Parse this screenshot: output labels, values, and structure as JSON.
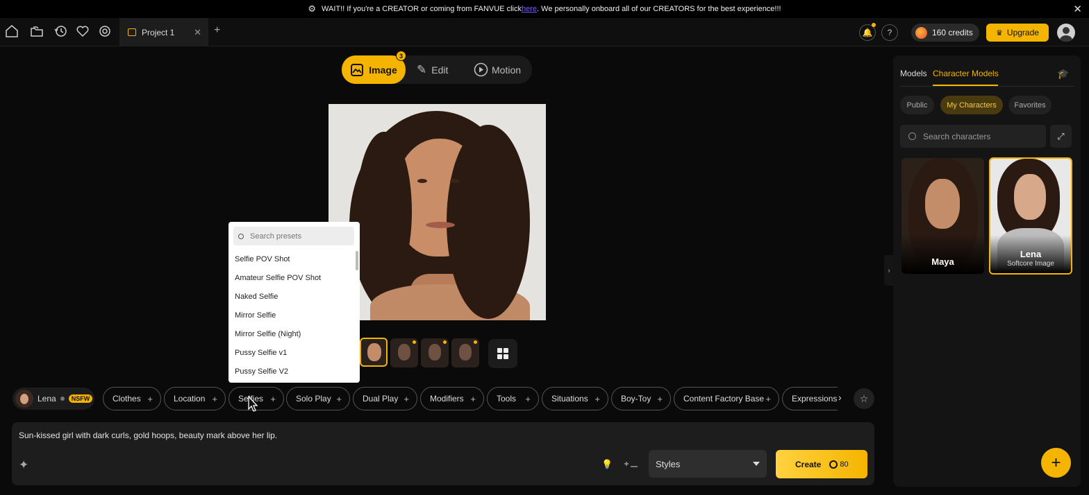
{
  "banner": {
    "text_before": "WAIT!! If you're a CREATOR or coming from FANVUE click ",
    "link": "here",
    "text_after": ". We personally onboard all of our CREATORS for the best experience!!!"
  },
  "tabs": [
    {
      "label": "Project 1"
    }
  ],
  "header": {
    "credits": "160 credits",
    "upgrade_label": "Upgrade"
  },
  "modes": {
    "image": "Image",
    "edit": "Edit",
    "motion": "Motion",
    "image_badge": "3"
  },
  "presets": {
    "search_placeholder": "Search presets",
    "items": [
      "Selfie POV Shot",
      "Amateur Selfie POV Shot",
      "Naked Selfie",
      "Mirror Selfie",
      "Mirror Selfie (Night)",
      "Pussy Selfie v1",
      "Pussy Selfie V2"
    ]
  },
  "character_chip": {
    "name": "Lena",
    "badge": "NSFW"
  },
  "categories": [
    "Clothes",
    "Location",
    "Selfies",
    "Solo Play",
    "Dual Play",
    "Modifiers",
    "Tools",
    "Situations",
    "Boy-Toy",
    "Content Factory Base",
    "Expressions"
  ],
  "prompt": {
    "text": "Sun-kissed girl with dark curls, gold hoops, beauty mark above her lip.",
    "styles_label": "Styles",
    "create_label": "Create",
    "create_cost": "80"
  },
  "panel": {
    "tab_models": "Models",
    "tab_character_models": "Character Models",
    "filters": [
      "Public",
      "My Characters",
      "Favorites"
    ],
    "search_placeholder": "Search characters",
    "characters": [
      {
        "name": "Maya",
        "subtitle": ""
      },
      {
        "name": "Lena",
        "subtitle": "Softcore Image"
      }
    ]
  },
  "colors": {
    "accent": "#f5b400",
    "background": "#0a0a0a",
    "panel": "#141414"
  }
}
